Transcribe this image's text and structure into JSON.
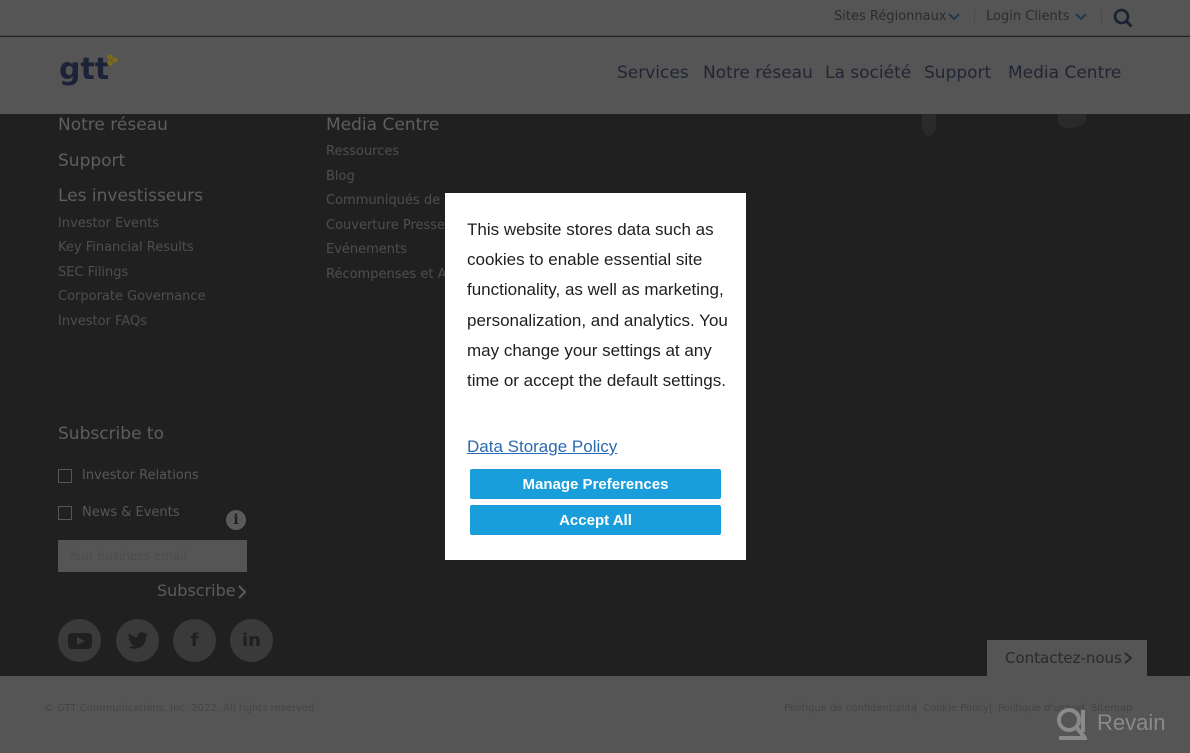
{
  "topbar": {
    "regional_sites": "Sites Régionnaux",
    "login_clients": "Login Clients",
    "search_icon": "search-icon"
  },
  "header": {
    "logo_text": "gtt",
    "nav": [
      "Services",
      "Notre réseau",
      "La société",
      "Support",
      "Media Centre"
    ]
  },
  "footer": {
    "col1": {
      "headings": [
        "Notre réseau",
        "Support",
        "Les investisseurs"
      ],
      "investor_links": [
        "Investor Events",
        "Key Financial Results",
        "SEC Filings",
        "Corporate Governance",
        "Investor FAQs"
      ]
    },
    "col2": {
      "heading": "Media Centre",
      "links": [
        "Ressources",
        "Blog",
        "Communiqués de P",
        "Couverture Presse",
        "Evénements",
        "Récompenses et An"
      ]
    },
    "subscribe": {
      "heading": "Subscribe to",
      "options": [
        {
          "label": "Investor Relations",
          "checked": false
        },
        {
          "label": "News & Events",
          "checked": false
        }
      ],
      "email_placeholder": "Your business email",
      "button_label": "Subscribe"
    },
    "social": [
      {
        "name": "youtube",
        "glyph": "▶"
      },
      {
        "name": "twitter",
        "glyph": "🐦"
      },
      {
        "name": "facebook",
        "glyph": "f"
      },
      {
        "name": "linkedin",
        "glyph": "in"
      }
    ],
    "contact_label": "Contactez-nous"
  },
  "bottombar": {
    "copyright": "© GTT Communications, Inc. 2022. All rights reserved",
    "legal_links": [
      "Politique de confidentialité",
      "Cookie Policy",
      "Politique d'usage",
      "Sitemap"
    ],
    "watermark": "Revain"
  },
  "cookie_modal": {
    "text": "This website stores data such as cookies to enable essential site functionality, as well as marketing, personalization, and analytics. You may change your settings at any time or accept the default settings.",
    "policy_link": "Data Storage Policy",
    "manage_button": "Manage Preferences",
    "accept_button": "Accept All",
    "button_color": "#1a9edb"
  }
}
